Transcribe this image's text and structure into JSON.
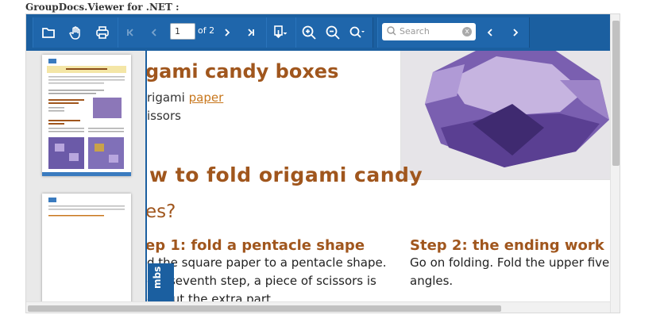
{
  "app": {
    "title": "GroupDocs.Viewer for .NET :"
  },
  "toolbar": {
    "current_page": "1",
    "page_of": "of 2",
    "search_placeholder": "Search",
    "search_clear": "x",
    "icons": [
      "folder-icon",
      "hand-icon",
      "print-icon",
      "first-page-icon",
      "prev-page-icon",
      "next-page-icon",
      "last-page-icon",
      "download-icon",
      "zoom-in-icon",
      "zoom-out-icon",
      "zoom-select-icon",
      "search-icon",
      "search-prev-icon",
      "search-next-icon"
    ]
  },
  "document": {
    "heading_fragment": "gami candy boxes",
    "materials_word1": "rigami ",
    "materials_link": "paper",
    "materials_word2": "issors",
    "howto_fragment": "w to fold origami candy",
    "howto_fragment2": "es?",
    "step1_title": "ep 1: fold a pentacle shape",
    "step1_line1": "d the square paper to a pentacle shape.",
    "step1_line2": "e a    seventh step, a piece of scissors is",
    "step1_line3": "de    cut the extra part",
    "step2_title": "Step 2: the ending work",
    "step2_line1": "Go on folding. Fold the upper five",
    "step2_line2": "angles."
  },
  "thumbnails": {
    "tab_label": "mbs",
    "page1_title": "How to fold origami candy boxes"
  },
  "colors": {
    "toolbar": "#1b5fa0",
    "heading": "#a0561d",
    "link": "#c8771d"
  }
}
